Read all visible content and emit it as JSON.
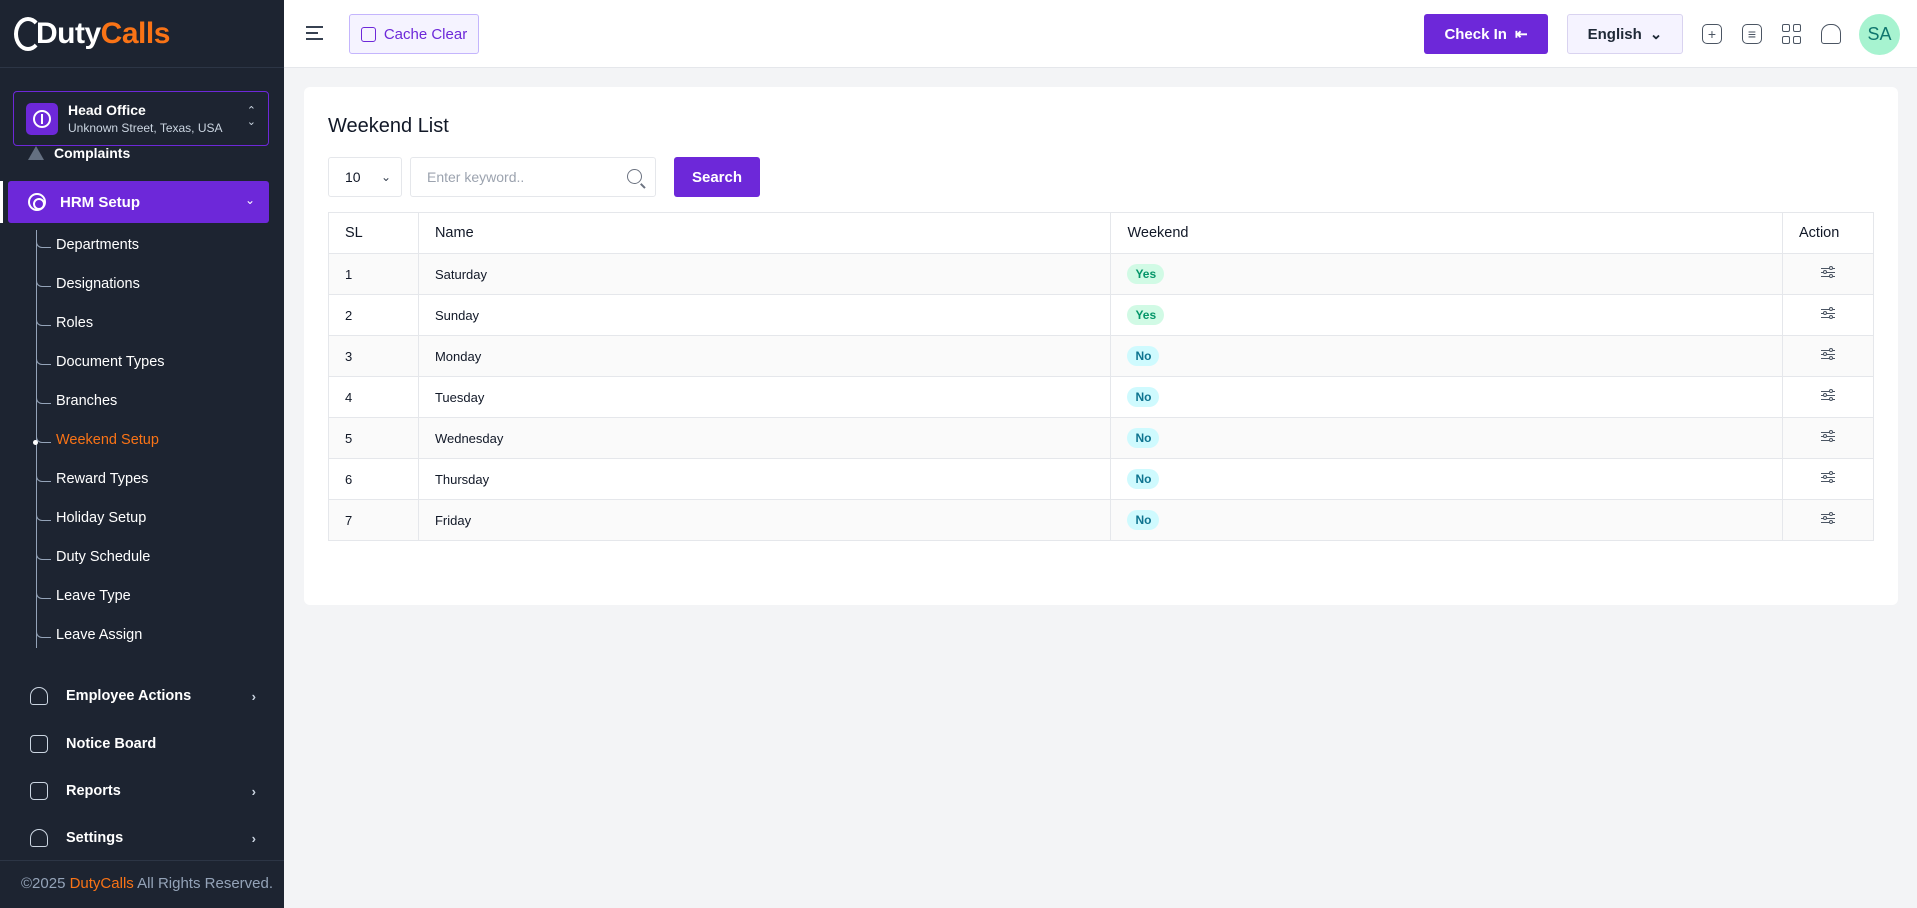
{
  "brand": {
    "part1": "Duty",
    "part2": "Calls"
  },
  "branch": {
    "name": "Head Office",
    "address": "Unknown Street, Texas, USA"
  },
  "sidebar": {
    "partial_item": "Complaints",
    "active_group": "HRM Setup",
    "sub_items": [
      "Departments",
      "Designations",
      "Roles",
      "Document Types",
      "Branches",
      "Weekend Setup",
      "Reward Types",
      "Holiday Setup",
      "Duty Schedule",
      "Leave Type",
      "Leave Assign"
    ],
    "active_sub": "Weekend Setup",
    "main_items": [
      "Employee Actions",
      "Notice Board",
      "Reports",
      "Settings"
    ],
    "footer": {
      "prefix": "©2025 ",
      "brand": "DutyCalls",
      "suffix": " All Rights Reserved."
    }
  },
  "topbar": {
    "cache_label": "Cache Clear",
    "checkin_label": "Check In",
    "language": "English",
    "avatar_initials": "SA"
  },
  "page": {
    "title": "Weekend List",
    "per_page": "10",
    "search_placeholder": "Enter keyword..",
    "search_button": "Search"
  },
  "table": {
    "headers": [
      "SL",
      "Name",
      "Weekend",
      "Action"
    ],
    "rows": [
      {
        "sl": "1",
        "name": "Saturday",
        "weekend": "Yes"
      },
      {
        "sl": "2",
        "name": "Sunday",
        "weekend": "Yes"
      },
      {
        "sl": "3",
        "name": "Monday",
        "weekend": "No"
      },
      {
        "sl": "4",
        "name": "Tuesday",
        "weekend": "No"
      },
      {
        "sl": "5",
        "name": "Wednesday",
        "weekend": "No"
      },
      {
        "sl": "6",
        "name": "Thursday",
        "weekend": "No"
      },
      {
        "sl": "7",
        "name": "Friday",
        "weekend": "No"
      }
    ]
  },
  "colors": {
    "accent": "#6d28d9",
    "brand_orange": "#f97316",
    "sidebar_bg": "#1d2431",
    "badge_yes": "#059669",
    "badge_no": "#0e7490"
  }
}
